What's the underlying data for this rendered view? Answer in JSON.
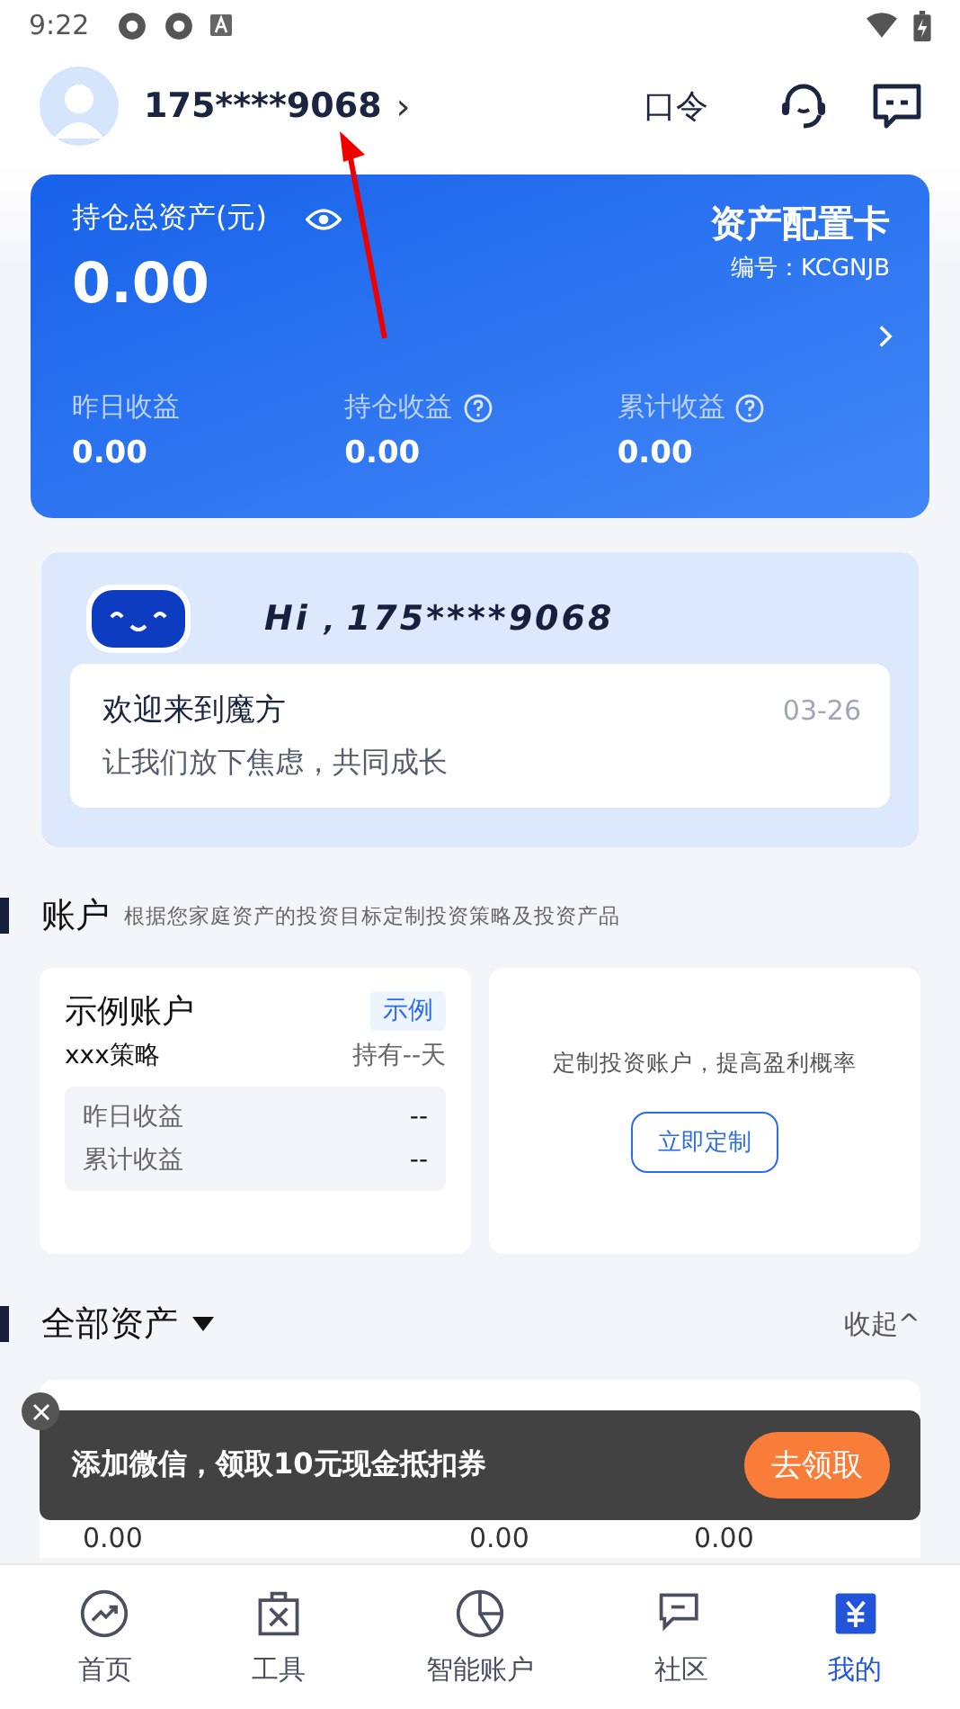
{
  "status_bar": {
    "time": "9:22"
  },
  "header": {
    "phone": "175****9068",
    "chevron": "›",
    "passcode": "口令"
  },
  "asset_card": {
    "label": "持仓总资产(元)",
    "total": "0.00",
    "card_title": "资产配置卡",
    "card_number": "编号：KCGNJB",
    "stats": [
      {
        "label": "昨日收益",
        "value": "0.00",
        "help": false
      },
      {
        "label": "持仓收益",
        "value": "0.00",
        "help": true
      },
      {
        "label": "累计收益",
        "value": "0.00",
        "help": true
      }
    ]
  },
  "greeting": {
    "hi": "Hi，175****9068",
    "title": "欢迎来到魔方",
    "date": "03-26",
    "message": "让我们放下焦虑，共同成长"
  },
  "accounts": {
    "title": "账户",
    "subtitle": "根据您家庭资产的投资目标定制投资策略及投资产品",
    "sample": {
      "name": "示例账户",
      "tag": "示例",
      "strategy": "xxx策略",
      "held": "持有--天",
      "rows": [
        {
          "label": "昨日收益",
          "value": "--"
        },
        {
          "label": "累计收益",
          "value": "--"
        }
      ]
    },
    "custom": {
      "text": "定制投资账户，提高盈利概率",
      "button": "立即定制"
    }
  },
  "assets": {
    "title": "全部资产",
    "collapse": "收起^",
    "fund": {
      "values": [
        "0.00",
        "0.00",
        "0.00"
      ]
    }
  },
  "toast": {
    "text": "添加微信，领取10元现金抵扣券",
    "button": "去领取"
  },
  "nav": [
    {
      "label": "首页",
      "selected": false
    },
    {
      "label": "工具",
      "selected": false
    },
    {
      "label": "智能账户",
      "selected": false
    },
    {
      "label": "社区",
      "selected": false
    },
    {
      "label": "我的",
      "selected": true
    }
  ]
}
